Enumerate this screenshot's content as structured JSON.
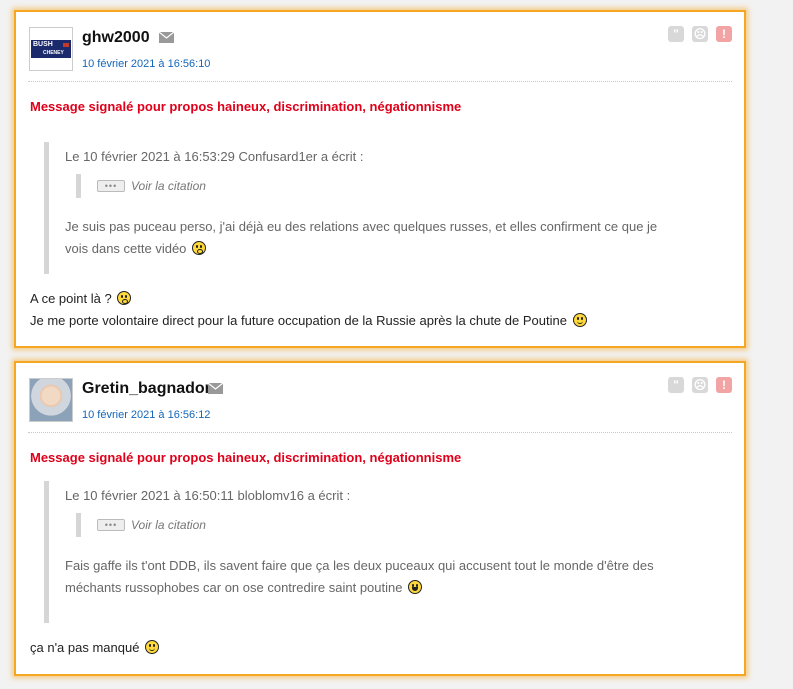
{
  "posts": [
    {
      "username": "ghw2000",
      "avatar": {
        "alt": "bush-cheney-logo",
        "text_top": "BUSH",
        "text_bottom": "CHENEY"
      },
      "date": "10 février 2021 à 16:56:10",
      "flag": "Message signalé pour propos haineux, discrimination, négationnisme",
      "quote": {
        "header": "Le 10 février 2021 à 16:53:29 Confusard1er a écrit :",
        "nested_label": "Voir la citation",
        "lines": [
          "Je suis pas puceau perso, j'ai déjà eu des relations avec quelques russes, et elles confirment ce que je",
          "vois dans cette vidéo"
        ],
        "end_smiley": "shocked-smiley"
      },
      "reply": [
        {
          "text": "A ce point là ?",
          "smiley": "shocked-smiley"
        },
        {
          "text": "Je me porte volontaire direct pour la future occupation de la Russie après la chute de Poutine",
          "smiley": "happy-smiley"
        }
      ]
    },
    {
      "username": "Gretin_bagnador",
      "avatar": {
        "alt": "user-photo"
      },
      "date": "10 février 2021 à 16:56:12",
      "flag": "Message signalé pour propos haineux, discrimination, négationnisme",
      "quote": {
        "header": "Le 10 février 2021 à 16:50:11 bloblomv16 a écrit :",
        "nested_label": "Voir la citation",
        "lines": [
          "Fais gaffe ils t'ont DDB, ils savent faire que ça les deux puceaux qui accusent tout le monde d'être des",
          "méchants russophobes car on ose contredire saint poutine"
        ],
        "end_smiley": "laughing-smiley"
      },
      "reply": [
        {
          "text": "ça n'a pas manqué",
          "smiley": "happy-smiley"
        }
      ]
    }
  ],
  "actions": {
    "quote": "\"",
    "sad": "☹",
    "alert": "!"
  },
  "colors": {
    "highlight_border": "#f5a623",
    "flag_red": "#e0001a",
    "date_blue": "#1466b8"
  }
}
